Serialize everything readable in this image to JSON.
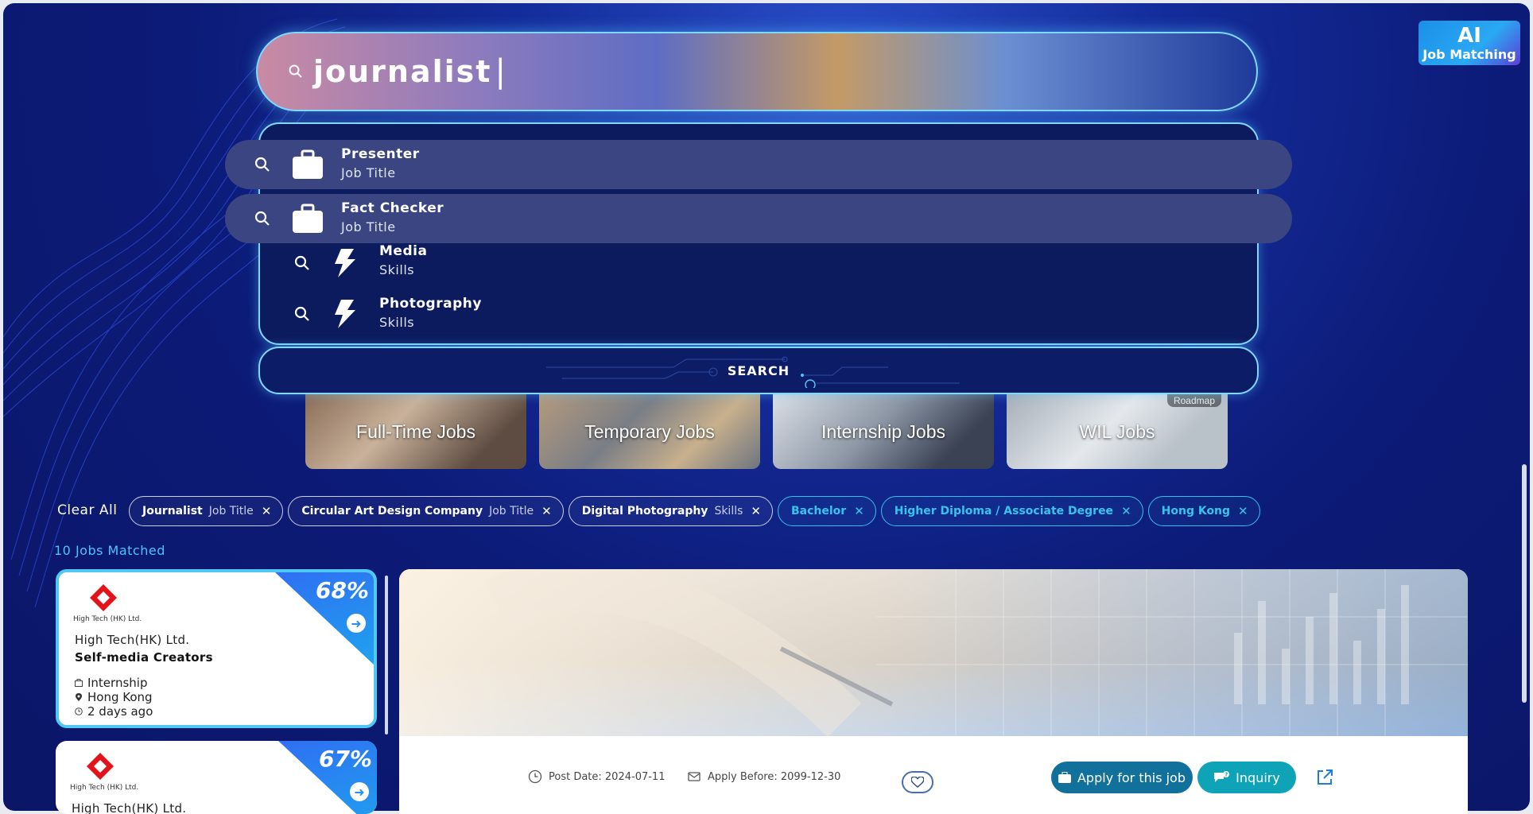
{
  "ai_badge": {
    "line1": "AI",
    "line2": "Job Matching"
  },
  "search": {
    "query": "journalist",
    "button_label": "SEARCH"
  },
  "suggestions": [
    {
      "name": "Presenter",
      "type": "Job Title",
      "icon": "briefcase-icon",
      "highlighted": true
    },
    {
      "name": "Fact Checker",
      "type": "Job Title",
      "icon": "briefcase-icon",
      "highlighted": true
    },
    {
      "name": "Media",
      "type": "Skills",
      "icon": "lightning-icon",
      "highlighted": false
    },
    {
      "name": "Photography",
      "type": "Skills",
      "icon": "lightning-icon",
      "highlighted": false
    }
  ],
  "categories": [
    {
      "label": "Full-Time Jobs"
    },
    {
      "label": "Temporary Jobs"
    },
    {
      "label": "Internship Jobs"
    },
    {
      "label": "WIL Jobs",
      "badge": "Roadmap"
    }
  ],
  "filters": {
    "clear_label": "Clear All",
    "chips": [
      {
        "name": "Journalist",
        "type": "Job Title",
        "style": "white"
      },
      {
        "name": "Circular Art Design Company",
        "type": "Job Title",
        "style": "white"
      },
      {
        "name": "Digital Photography",
        "type": "Skills",
        "style": "white"
      },
      {
        "name": "Bachelor",
        "type": "",
        "style": "cyan"
      },
      {
        "name": "Higher Diploma / Associate Degree",
        "type": "",
        "style": "cyan"
      },
      {
        "name": "Hong Kong",
        "type": "",
        "style": "cyan"
      }
    ],
    "remove_glyph": "✕"
  },
  "results": {
    "count_label": "10 Jobs Matched",
    "jobs": [
      {
        "logo_text": "High Tech (HK) Ltd.",
        "company": "High Tech(HK) Ltd.",
        "title": "Self-media Creators",
        "match": "68%",
        "job_type": "Internship",
        "location": "Hong Kong",
        "posted": "2 days ago"
      },
      {
        "logo_text": "High Tech (HK) Ltd.",
        "company": "High Tech(HK) Ltd.",
        "title": "",
        "match": "67%",
        "job_type": "",
        "location": "",
        "posted": ""
      }
    ]
  },
  "detail": {
    "post_date": "Post Date: 2024-07-11",
    "apply_before": "Apply Before: 2099-12-30",
    "apply_label": "Apply for this job",
    "inquiry_label": "Inquiry"
  },
  "colors": {
    "background": "#0c1b78",
    "accent_cyan": "#38c4ea",
    "apply_button": "#12719a",
    "inquiry_button": "#0ea3b6",
    "match_badge": "#1fa2ef"
  }
}
